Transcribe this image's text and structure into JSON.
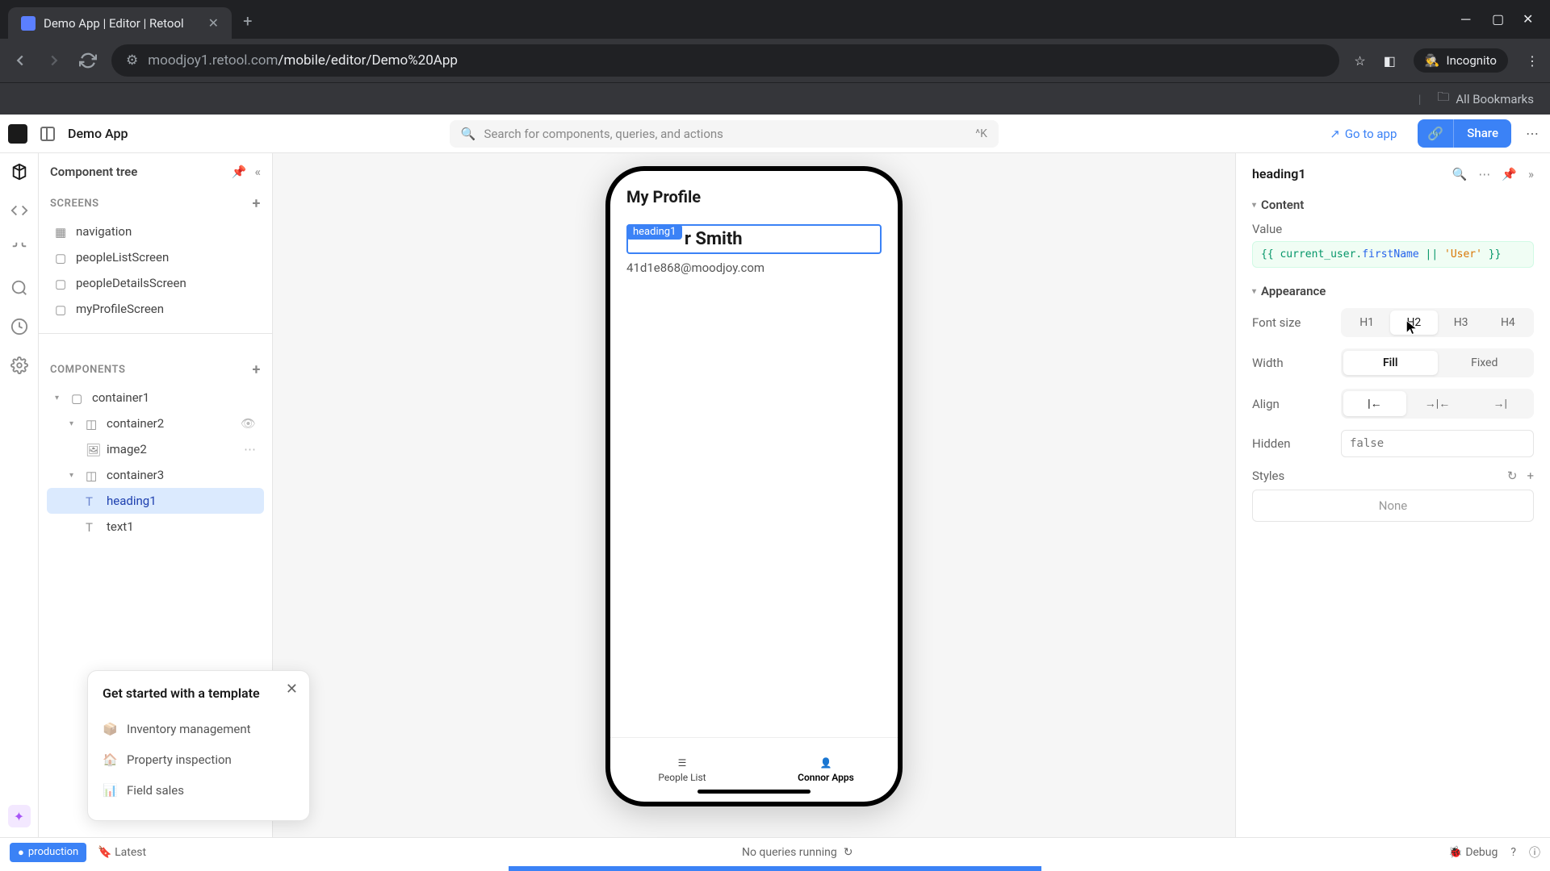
{
  "browser": {
    "tab_title": "Demo App | Editor | Retool",
    "url_host": "moodjoy1.retool.com",
    "url_path": "/mobile/editor/Demo%20App",
    "incognito": "Incognito",
    "bookmarks": "All Bookmarks"
  },
  "header": {
    "app_title": "Demo App",
    "search_placeholder": "Search for components, queries, and actions",
    "search_shortcut": "^K",
    "goto_app": "Go to app",
    "share": "Share"
  },
  "left_panel": {
    "title": "Component tree",
    "screens_label": "SCREENS",
    "components_label": "COMPONENTS",
    "screens": [
      {
        "name": "navigation"
      },
      {
        "name": "peopleListScreen"
      },
      {
        "name": "peopleDetailsScreen"
      },
      {
        "name": "myProfileScreen"
      }
    ],
    "components": {
      "c1": "container1",
      "c2": "container2",
      "img": "image2",
      "c3": "container3",
      "h1": "heading1",
      "t1": "text1"
    }
  },
  "template_popup": {
    "title": "Get started with a template",
    "items": [
      "Inventory management",
      "Property inspection",
      "Field sales"
    ]
  },
  "phone": {
    "page_title": "My Profile",
    "tag": "heading1",
    "heading_visible": "r Smith",
    "email": "41d1e868@moodjoy.com",
    "tabs": [
      "People List",
      "Connor Apps"
    ]
  },
  "inspector": {
    "component_name": "heading1",
    "content_section": "Content",
    "value_label": "Value",
    "value_code_prefix": "{{ current_user.",
    "value_code_prop": "firstName",
    "value_code_mid": " || ",
    "value_code_str": "'User'",
    "value_code_suffix": " }}",
    "appearance_section": "Appearance",
    "font_label": "Font size",
    "font_options": [
      "H1",
      "H2",
      "H3",
      "H4"
    ],
    "width_label": "Width",
    "width_options": [
      "Fill",
      "Fixed"
    ],
    "align_label": "Align",
    "hidden_label": "Hidden",
    "hidden_placeholder": "false",
    "styles_label": "Styles",
    "styles_none": "None"
  },
  "footer": {
    "env": "production",
    "latest": "Latest",
    "queries": "No queries running",
    "debug": "Debug"
  }
}
